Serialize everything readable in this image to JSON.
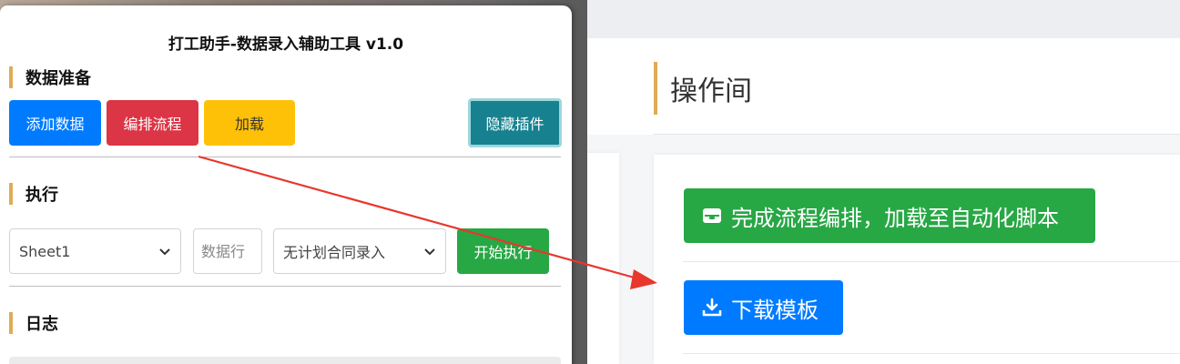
{
  "background": {
    "section_title": "操作间",
    "buttons": [
      {
        "label": "完成流程编排，加载至自动化脚本",
        "icon": "inbox-tray-icon",
        "color": "#28a745"
      },
      {
        "label": "下载模板",
        "icon": "download-icon",
        "color": "#007bff"
      }
    ]
  },
  "panel": {
    "title": "打工助手-数据录入辅助工具 v1.0",
    "sections": {
      "prepare": {
        "title": "数据准备",
        "buttons": {
          "add": {
            "label": "添加数据",
            "color": "#007bff"
          },
          "orchestrate": {
            "label": "编排流程",
            "color": "#dc3545"
          },
          "load": {
            "label": "加载",
            "color": "#ffc107"
          },
          "hide": {
            "label": "隐藏插件",
            "color": "#17818f"
          }
        }
      },
      "execute": {
        "title": "执行",
        "sheet_select": {
          "value": "Sheet1"
        },
        "row_input": {
          "placeholder": "数据行"
        },
        "mode_select": {
          "value": "无计划合同录入"
        },
        "start_button": {
          "label": "开始执行",
          "color": "#28a745"
        }
      },
      "log": {
        "title": "日志"
      }
    }
  },
  "annotation": {
    "color": "#e8372c"
  },
  "colors": {
    "accent_bar": "#e0ab55"
  }
}
